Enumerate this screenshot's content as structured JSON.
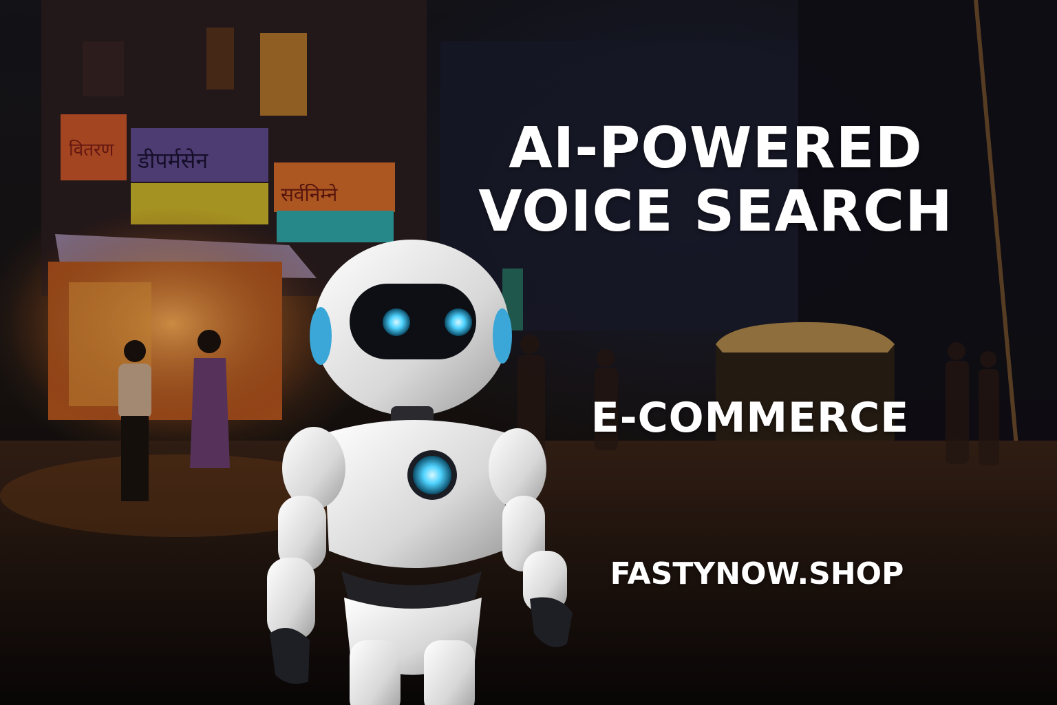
{
  "headline": {
    "line1": "AI-POWERED",
    "line2": "VOICE SEARCH"
  },
  "subhead": "E-COMMERCE",
  "website": "FASTYNOW.SHOP",
  "shop_signs": [
    "वितरण",
    "डीपर्मसेन",
    "सर्वनिम्ने"
  ],
  "colors": {
    "text": "#ffffff",
    "robot_glow": "#4fd3ff",
    "shop_light": "#e8822a",
    "night_blue": "#1e2d5a"
  }
}
